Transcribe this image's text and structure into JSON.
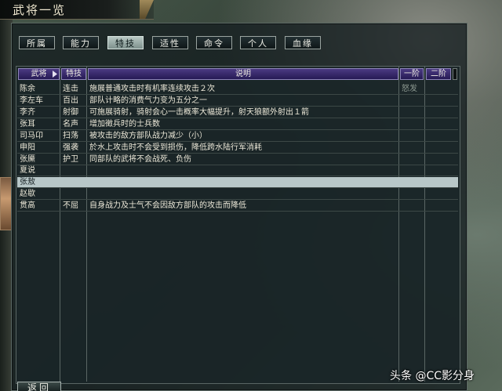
{
  "window": {
    "title": "武将一览"
  },
  "tabs": [
    {
      "label": "所属",
      "active": false
    },
    {
      "label": "能力",
      "active": false
    },
    {
      "label": "特技",
      "active": true
    },
    {
      "label": "适性",
      "active": false
    },
    {
      "label": "命令",
      "active": false
    },
    {
      "label": "个人",
      "active": false
    },
    {
      "label": "血缘",
      "active": false
    }
  ],
  "table": {
    "headers": {
      "name": "武将",
      "skill": "特技",
      "desc": "说明",
      "lv1": "一阶",
      "lv2": "二阶"
    },
    "rows": [
      {
        "name": "陈余",
        "skill": "连击",
        "desc": "施展普通攻击时有机率连续攻击２次",
        "lv1": "怒发",
        "selected": false
      },
      {
        "name": "李左车",
        "skill": "百出",
        "desc": "部队计略的消费气力变为五分之一",
        "lv1": "",
        "selected": false
      },
      {
        "name": "李齐",
        "skill": "射御",
        "desc": "可施展骑射，骑射会心一击概率大幅提升，射天狼额外射出１箭",
        "lv1": "",
        "selected": false
      },
      {
        "name": "张耳",
        "skill": "名声",
        "desc": "增加徵兵时的士兵数",
        "lv1": "",
        "selected": false
      },
      {
        "name": "司马卬",
        "skill": "扫荡",
        "desc": "被攻击的敌方部队战力减少（小）",
        "lv1": "",
        "selected": false
      },
      {
        "name": "申阳",
        "skill": "强袭",
        "desc": "於水上攻击时不会受到损伤，降低跨水陆行军消耗",
        "lv1": "",
        "selected": false
      },
      {
        "name": "张黡",
        "skill": "护卫",
        "desc": "同部队的武将不会战死、负伤",
        "lv1": "",
        "selected": false
      },
      {
        "name": "夏说",
        "skill": "",
        "desc": "",
        "lv1": "",
        "selected": false
      },
      {
        "name": "张敖",
        "skill": "",
        "desc": "",
        "lv1": "",
        "selected": true
      },
      {
        "name": "赵歇",
        "skill": "",
        "desc": "",
        "lv1": "",
        "selected": false
      },
      {
        "name": "贯高",
        "skill": "不屈",
        "desc": "自身战力及士气不会因敌方部队的攻击而降低",
        "lv1": "",
        "selected": false
      }
    ]
  },
  "footer": {
    "back_label": "返回"
  },
  "watermark": "头条 @CC影分身"
}
